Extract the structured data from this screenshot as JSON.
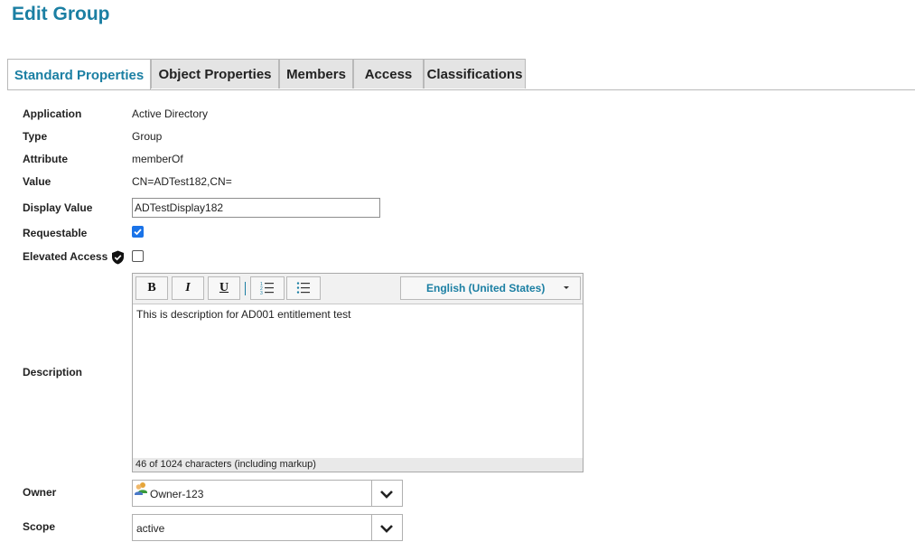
{
  "page": {
    "title": "Edit Group"
  },
  "tabs": [
    {
      "label": "Standard Properties",
      "active": true
    },
    {
      "label": "Object Properties",
      "active": false
    },
    {
      "label": "Members",
      "active": false
    },
    {
      "label": "Access",
      "active": false
    },
    {
      "label": "Classifications",
      "active": false
    }
  ],
  "fields": {
    "application": {
      "label": "Application",
      "value": "Active Directory"
    },
    "type": {
      "label": "Type",
      "value": "Group"
    },
    "attribute": {
      "label": "Attribute",
      "value": "memberOf"
    },
    "value": {
      "label": "Value",
      "value": "CN=ADTest182,CN="
    },
    "display_value": {
      "label": "Display Value",
      "value": "ADTestDisplay182"
    },
    "requestable": {
      "label": "Requestable",
      "checked": true
    },
    "elevated_access": {
      "label": "Elevated Access",
      "checked": false,
      "icon": "shield-check-icon"
    },
    "description": {
      "label": "Description",
      "toolbar": {
        "bold": "B",
        "italic": "I",
        "underline": "U",
        "language": "English (United States)"
      },
      "text": "This is description for AD001 entitlement test",
      "char_count": "46 of 1024 characters (including markup)"
    },
    "owner": {
      "label": "Owner",
      "value": "Owner-123",
      "icon": "identity-users-icon"
    },
    "scope": {
      "label": "Scope",
      "value": "active"
    }
  },
  "colors": {
    "accent": "#1b7fa3",
    "checkbox": "#1a73e8"
  }
}
